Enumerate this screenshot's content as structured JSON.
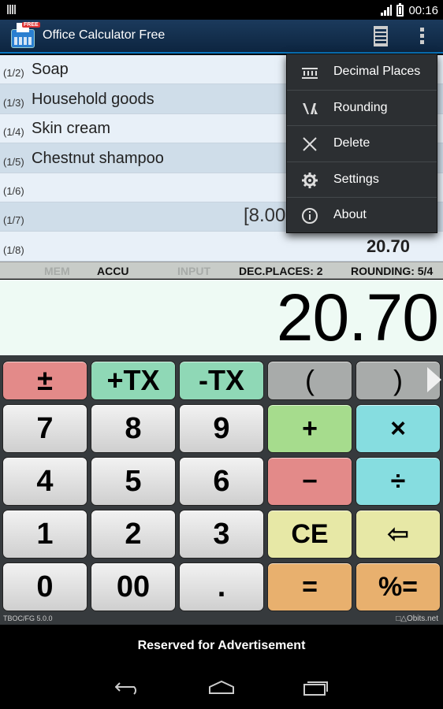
{
  "status_bar": {
    "time": "00:16"
  },
  "app": {
    "title": "Office Calculator Free",
    "icon_badge": "FREE"
  },
  "tape": {
    "rows": [
      {
        "index": "(1/2)",
        "text": "Soap",
        "value": ""
      },
      {
        "index": "(1/3)",
        "text": "Household goods",
        "value": ""
      },
      {
        "index": "(1/4)",
        "text": "Skin cream",
        "value": ""
      },
      {
        "index": "(1/5)",
        "text": "Chestnut shampoo",
        "value": ""
      },
      {
        "index": "(1/6)",
        "text": "",
        "value": ""
      },
      {
        "index": "(1/7)",
        "text": "",
        "value": "[8.00"
      },
      {
        "index": "(1/8)",
        "text": "",
        "value": "20.70"
      }
    ]
  },
  "status_strip": {
    "mem": "MEM",
    "accu": "ACCU",
    "input": "INPUT",
    "dec_places": "DEC.PLACES: 2",
    "rounding": "ROUNDING: 5/4"
  },
  "display": {
    "value": "20.70"
  },
  "keys": {
    "plusminus": "±",
    "plus_tx": "+TX",
    "minus_tx": "-TX",
    "open_paren": "(",
    "close_paren": ")",
    "seven": "7",
    "eight": "8",
    "nine": "9",
    "add": "+",
    "multiply": "×",
    "four": "4",
    "five": "5",
    "six": "6",
    "subtract": "−",
    "divide": "÷",
    "one": "1",
    "two": "2",
    "three": "3",
    "clear_entry": "CE",
    "backspace": "⇦",
    "zero": "0",
    "double_zero": "00",
    "decimal": ".",
    "equals": "=",
    "percent_equals": "%="
  },
  "footer": {
    "version": "TBOC/FG 5.0.0",
    "brand": "bits.net"
  },
  "ad": {
    "text": "Reserved for Advertisement"
  },
  "menu": {
    "items": [
      {
        "label": "Decimal Places",
        "icon": "decimal-places-icon"
      },
      {
        "label": "Rounding",
        "icon": "rounding-icon"
      },
      {
        "label": "Delete",
        "icon": "close-icon"
      },
      {
        "label": "Settings",
        "icon": "gear-icon"
      },
      {
        "label": "About",
        "icon": "info-icon"
      }
    ]
  },
  "colors": {
    "action_bar": "#1b3a5c",
    "keypad_bg": "#363a3d",
    "display_bg": "#eefaf4",
    "menu_bg": "#2c2f32"
  }
}
